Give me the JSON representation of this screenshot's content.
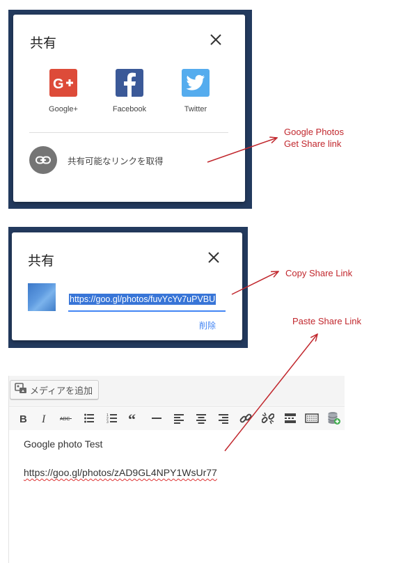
{
  "panel1": {
    "title": "共有",
    "services": [
      {
        "label": "Google+",
        "icon": "google-plus-icon",
        "color": "#dd4b39"
      },
      {
        "label": "Facebook",
        "icon": "facebook-icon",
        "color": "#3b5998"
      },
      {
        "label": "Twitter",
        "icon": "twitter-icon",
        "color": "#55acee"
      }
    ],
    "get_link_label": "共有可能なリンクを取得"
  },
  "panel2": {
    "title": "共有",
    "share_url": "https://goo.gl/photos/fuvYcYv7uPVBU",
    "delete_label": "削除"
  },
  "editor": {
    "add_media_label": "メディアを追加",
    "toolbar": [
      "bold-icon",
      "italic-icon",
      "strikethrough-icon",
      "bullet-list-icon",
      "numbered-list-icon",
      "blockquote-icon",
      "horizontal-rule-icon",
      "align-left-icon",
      "align-center-icon",
      "align-right-icon",
      "link-icon",
      "unlink-icon",
      "read-more-icon",
      "toolbar-toggle-icon",
      "database-add-icon"
    ],
    "text_line1": "Google photo Test",
    "text_line2": "https://goo.gl/photos/zAD9GL4NPY1WsUr77"
  },
  "annotations": {
    "a1_line1": "Google Photos",
    "a1_line2": "Get Share link",
    "a2": "Copy Share Link",
    "a3": "Paste Share Link",
    "color": "#c1272d"
  }
}
